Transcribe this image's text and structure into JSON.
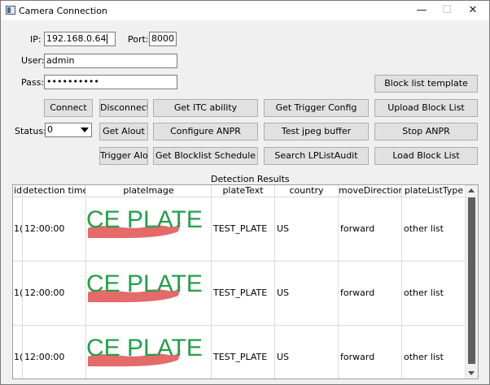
{
  "window": {
    "title": "Camera Connection",
    "controls": {
      "minimize": "—",
      "maximize": "☐",
      "close": "✕"
    }
  },
  "connection": {
    "ip_label": "IP:",
    "ip_value": "192.168.0.64",
    "port_label": "Port:",
    "port_value": "8000",
    "user_label": "User:",
    "user_value": "admin",
    "pass_label": "Pass:",
    "pass_value": "••••••••••",
    "status_label": "Status:",
    "status_value": "0"
  },
  "buttons": {
    "block_list_template": "Block list template",
    "connect": "Connect",
    "disconnect": "Disconnect",
    "get_itc_ability": "Get ITC ability",
    "get_trigger_config": "Get Trigger Config",
    "upload_block_list": "Upload Block List",
    "get_alout": "Get Alout",
    "configure_anpr": "Configure ANPR",
    "test_jpeg_buffer": "Test jpeg buffer",
    "stop_anpr": "Stop ANPR",
    "trigger_alout": "Trigger Alout",
    "get_blocklist_schedule": "Get Blocklist Schedule",
    "search_lplistaudit": "Search LPListAudit",
    "load_block_list": "Load Block List"
  },
  "results": {
    "title": "Detection Results",
    "columns": [
      "id",
      "detection time",
      "plateImage",
      "plateText",
      "country",
      "moveDirection",
      "plateListType"
    ],
    "rows": [
      {
        "id": "1(",
        "time": "12:00:00",
        "image_text": "CE PLATE",
        "plateText": "TEST_PLATE",
        "country": "US",
        "moveDirection": "forward",
        "plateListType": "other list"
      },
      {
        "id": "1(",
        "time": "12:00:00",
        "image_text": "CE PLATE",
        "plateText": "TEST_PLATE",
        "country": "US",
        "moveDirection": "forward",
        "plateListType": "other list"
      },
      {
        "id": "1(",
        "time": "12:00:00",
        "image_text": "CE PLATE",
        "plateText": "TEST_PLATE",
        "country": "US",
        "moveDirection": "forward",
        "plateListType": "other list"
      }
    ]
  },
  "colors": {
    "plate_text": "#22a04a",
    "plate_smear": "#e05050",
    "button_face": "#e1e1e1"
  }
}
